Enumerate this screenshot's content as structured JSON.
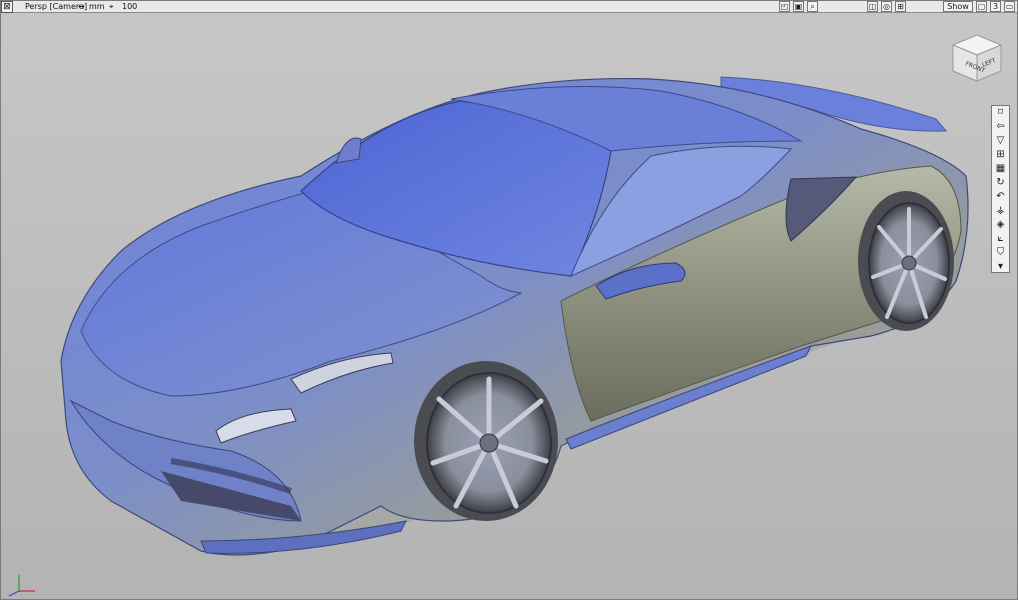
{
  "toolbar": {
    "camera_label": "Persp [Camera]",
    "units_label": "mm",
    "grid_label": "100",
    "show_button": "Show",
    "layer_count": "3"
  },
  "view_cube": {
    "front_label": "FRONT",
    "left_label": "LEFT"
  },
  "side_tools": [
    {
      "icon": "frame-icon",
      "glyph": "⌑"
    },
    {
      "icon": "arrow-left-icon",
      "glyph": "⇦"
    },
    {
      "icon": "shield-icon",
      "glyph": "▽"
    },
    {
      "icon": "grid-icon",
      "glyph": "⊞"
    },
    {
      "icon": "checker-icon",
      "glyph": "▦"
    },
    {
      "icon": "rotate-cw-icon",
      "glyph": "↻"
    },
    {
      "icon": "undo-icon",
      "glyph": "↶"
    },
    {
      "icon": "pivot-icon",
      "glyph": "⚶"
    },
    {
      "icon": "tag-icon",
      "glyph": "◈"
    },
    {
      "icon": "axis-icon",
      "glyph": "⟀"
    },
    {
      "icon": "bookmark-icon",
      "glyph": "⛉"
    },
    {
      "icon": "more-icon",
      "glyph": "▾"
    }
  ],
  "colors": {
    "viewport_top": "#c7c7c7",
    "viewport_bottom": "#b3b3b3",
    "car_blue": "#5b74d8",
    "car_silver": "#9ea08f"
  }
}
